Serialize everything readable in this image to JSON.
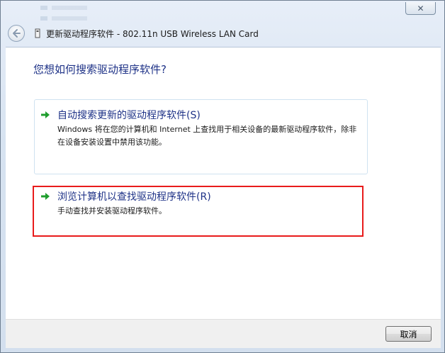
{
  "window": {
    "title": "更新驱动程序软件 - 802.11n USB Wireless LAN Card",
    "close_glyph": "✕"
  },
  "heading": "您想如何搜索驱动程序软件?",
  "options": [
    {
      "title": "自动搜索更新的驱动程序软件(S)",
      "description": "Windows 将在您的计算机和 Internet 上查找用于相关设备的最新驱动程序软件，除非在设备安装设置中禁用该功能。",
      "icon": "green-arrow-icon",
      "highlighted": false
    },
    {
      "title": "浏览计算机以查找驱动程序软件(R)",
      "description": "手动查找并安装驱动程序软件。",
      "icon": "green-arrow-icon",
      "highlighted": true
    }
  ],
  "footer": {
    "cancel_label": "取消"
  },
  "colors": {
    "heading": "#1e3287",
    "highlight_border": "#e81b1b",
    "arrow": "#1f9e2e"
  }
}
